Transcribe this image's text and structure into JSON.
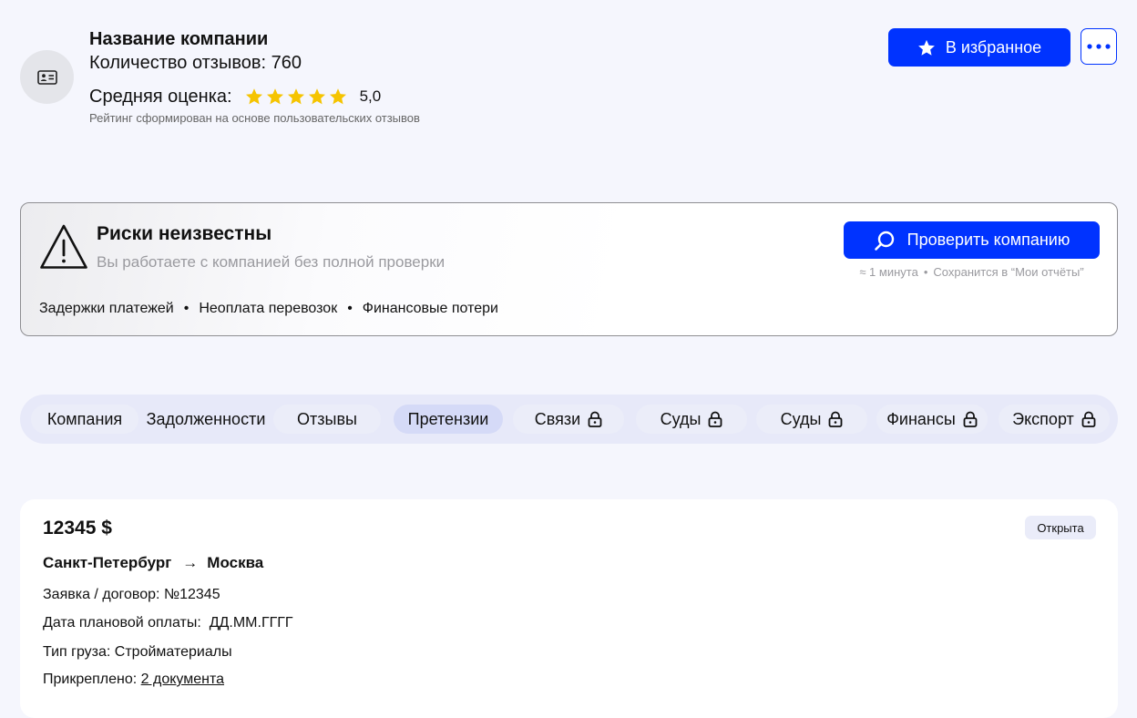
{
  "header": {
    "company_name": "Название компании",
    "reviews_count_text": "Количество отзывов: 760",
    "rating_label": "Средняя оценка:",
    "rating_stars": 5,
    "rating_max": 5,
    "rating_value": "5,0",
    "rating_note": "Рейтинг сформирован на основе пользовательских отзывов",
    "favorite_button_label": "В избранное",
    "favorite_icon": "star-icon",
    "more_icon": "more-dots-icon",
    "avatar_icon": "id-card-icon",
    "accent_color": "#0033ff",
    "star_color": "#f5c400"
  },
  "risk": {
    "title": "Риски неизвестны",
    "subtitle": "Вы работаете с компанией без полной проверки",
    "icon": "warning-icon",
    "check_button_label": "Проверить компанию",
    "check_button_icon": "search-icon",
    "check_time": "≈ 1 минута",
    "check_save_note": "Сохранится в “Мои отчёты”",
    "tags": [
      "Задержки платежей",
      "Неоплата перевозок",
      "Финансовые потери"
    ]
  },
  "tabs": [
    {
      "label": "Компания",
      "locked": false,
      "active": false
    },
    {
      "label": "Задолженности",
      "locked": false,
      "active": false
    },
    {
      "label": "Отзывы",
      "locked": false,
      "active": false
    },
    {
      "label": "Претензии",
      "locked": false,
      "active": true
    },
    {
      "label": "Связи",
      "locked": true,
      "active": false
    },
    {
      "label": "Суды",
      "locked": true,
      "active": false
    },
    {
      "label": "Суды",
      "locked": true,
      "active": false
    },
    {
      "label": "Финансы",
      "locked": true,
      "active": false
    },
    {
      "label": "Экспорт",
      "locked": true,
      "active": false
    }
  ],
  "claim": {
    "amount": "12345 $",
    "status": "Открыта",
    "route_from": "Санкт-Петербург",
    "route_arrow": "→",
    "route_to": "Москва",
    "contract": "Заявка / договор: №12345",
    "payment_date": "Дата плановой оплаты:  ДД.ММ.ГГГГ",
    "cargo_type": "Тип груза: Стройматериалы",
    "attached_label": "Прикреплено: ",
    "attached_link": "2 документа"
  }
}
